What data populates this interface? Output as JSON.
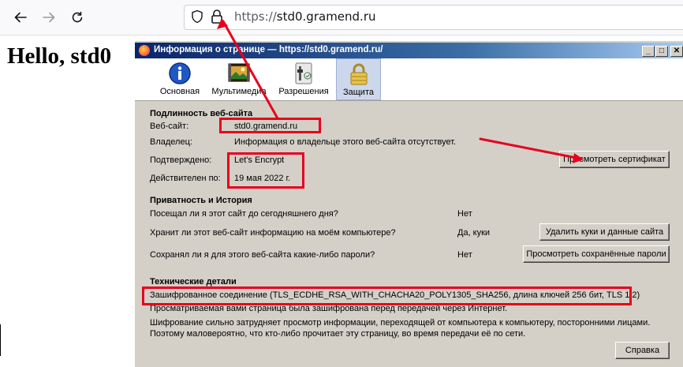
{
  "browser": {
    "back_icon": "back-arrow-icon",
    "forward_icon": "forward-arrow-icon",
    "reload_icon": "reload-icon",
    "url_prefix": "https://",
    "url_host": "std0.gramend.ru"
  },
  "page": {
    "heading": "Hello, std0"
  },
  "dialog": {
    "title": "Информация о странице — https://std0.gramend.ru/",
    "window_buttons": {
      "minimize": "_",
      "maximize": "□",
      "close": "✕"
    },
    "tabs": [
      {
        "label": "Основная",
        "icon": "info-icon"
      },
      {
        "label": "Мультимедиа",
        "icon": "media-icon"
      },
      {
        "label": "Разрешения",
        "icon": "permissions-icon"
      },
      {
        "label": "Защита",
        "icon": "lock-icon",
        "selected": true
      }
    ],
    "identity": {
      "title": "Подлинность веб-сайта",
      "website_label": "Веб-сайт:",
      "website_value": "std0.gramend.ru",
      "owner_label": "Владелец:",
      "owner_value": "Информация о владельце этого веб-сайта отсутствует.",
      "verified_label": "Подтверждено:",
      "verified_value": "Let's Encrypt",
      "expires_label": "Действителен по:",
      "expires_value": "19 мая 2022 г.",
      "view_cert_button": "Просмотреть сертификат"
    },
    "privacy": {
      "title": "Приватность и История",
      "q1": "Посещал ли я этот сайт до сегодняшнего дня?",
      "a1": "Нет",
      "q2": "Хранит ли этот веб-сайт информацию на моём компьютере?",
      "a2": "Да, куки",
      "clear_cookies_button": "Удалить куки и данные сайта",
      "q3": "Сохранял ли я для этого веб-сайта какие-либо пароли?",
      "a3": "Нет",
      "view_passwords_button": "Просмотреть сохранённые пароли"
    },
    "technical": {
      "title": "Технические детали",
      "line1": "Зашифрованное соединение (TLS_ECDHE_RSA_WITH_CHACHA20_POLY1305_SHA256, длина ключей 256 бит, TLS 1.2)",
      "line2": "Просматриваемая вами страница была зашифрована перед передачей через Интернет.",
      "line3": "Шифрование сильно затрудняет просмотр информации, переходящей от компьютера к компьютеру, посторонними лицами.",
      "line4": "Поэтому маловероятно, что кто-либо прочитает эту страницу, во время передачи её по сети."
    },
    "help_button": "Справка"
  },
  "colors": {
    "highlight": "#e8001c",
    "dialog_bg": "#d4d0c8",
    "title_bar": "#0a246a"
  }
}
